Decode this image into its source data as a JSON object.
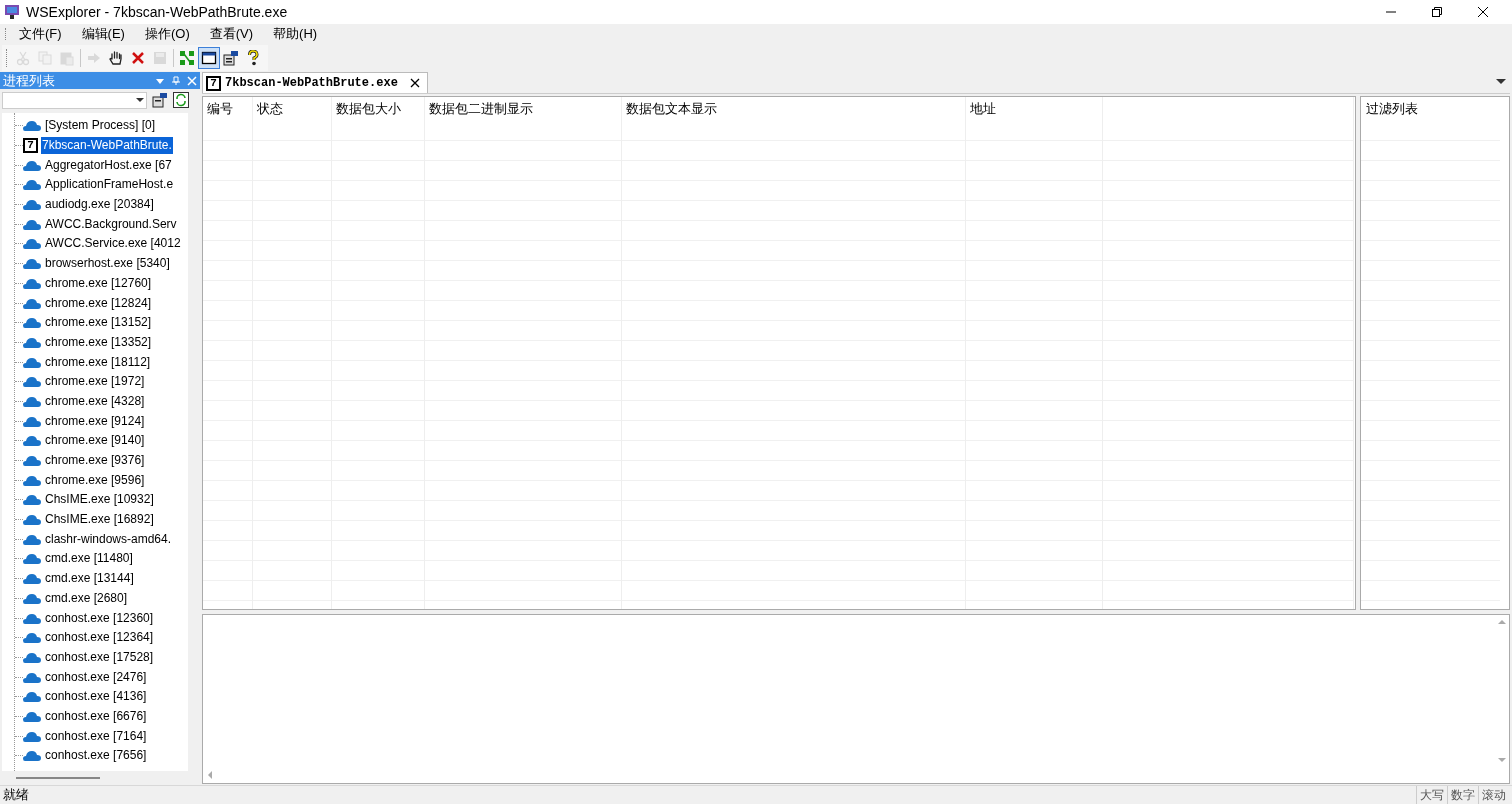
{
  "window": {
    "title": "WSExplorer - 7kbscan-WebPathBrute.exe"
  },
  "menu": [
    {
      "label": "文件(F)"
    },
    {
      "label": "编辑(E)"
    },
    {
      "label": "操作(O)"
    },
    {
      "label": "查看(V)"
    },
    {
      "label": "帮助(H)"
    }
  ],
  "toolbar": [
    {
      "kind": "cut",
      "disabled": true
    },
    {
      "kind": "copy",
      "disabled": true
    },
    {
      "kind": "paste",
      "disabled": true
    },
    {
      "kind": "sep"
    },
    {
      "kind": "forward",
      "disabled": true
    },
    {
      "kind": "hand",
      "disabled": false
    },
    {
      "kind": "delete",
      "disabled": false
    },
    {
      "kind": "save",
      "disabled": true
    },
    {
      "kind": "sep"
    },
    {
      "kind": "nodes",
      "disabled": false
    },
    {
      "kind": "window",
      "disabled": false,
      "selected": true
    },
    {
      "kind": "props",
      "disabled": false
    },
    {
      "kind": "help",
      "disabled": false
    }
  ],
  "sidebar": {
    "title": "进程列表",
    "items": [
      {
        "label": "[System Process] [0]",
        "kind": "cloud",
        "selected": false
      },
      {
        "label": "7kbscan-WebPathBrute.",
        "kind": "seven",
        "icon_label": "7",
        "selected": true
      },
      {
        "label": "AggregatorHost.exe [67",
        "kind": "cloud",
        "selected": false
      },
      {
        "label": "ApplicationFrameHost.e",
        "kind": "cloud",
        "selected": false
      },
      {
        "label": "audiodg.exe [20384]",
        "kind": "cloud",
        "selected": false
      },
      {
        "label": "AWCC.Background.Serv",
        "kind": "cloud",
        "selected": false
      },
      {
        "label": "AWCC.Service.exe [4012",
        "kind": "cloud",
        "selected": false
      },
      {
        "label": "browserhost.exe [5340]",
        "kind": "cloud",
        "selected": false
      },
      {
        "label": "chrome.exe [12760]",
        "kind": "cloud",
        "selected": false
      },
      {
        "label": "chrome.exe [12824]",
        "kind": "cloud",
        "selected": false
      },
      {
        "label": "chrome.exe [13152]",
        "kind": "cloud",
        "selected": false
      },
      {
        "label": "chrome.exe [13352]",
        "kind": "cloud",
        "selected": false
      },
      {
        "label": "chrome.exe [18112]",
        "kind": "cloud",
        "selected": false
      },
      {
        "label": "chrome.exe [1972]",
        "kind": "cloud",
        "selected": false
      },
      {
        "label": "chrome.exe [4328]",
        "kind": "cloud",
        "selected": false
      },
      {
        "label": "chrome.exe [9124]",
        "kind": "cloud",
        "selected": false
      },
      {
        "label": "chrome.exe [9140]",
        "kind": "cloud",
        "selected": false
      },
      {
        "label": "chrome.exe [9376]",
        "kind": "cloud",
        "selected": false
      },
      {
        "label": "chrome.exe [9596]",
        "kind": "cloud",
        "selected": false
      },
      {
        "label": "ChsIME.exe [10932]",
        "kind": "cloud",
        "selected": false
      },
      {
        "label": "ChsIME.exe [16892]",
        "kind": "cloud",
        "selected": false
      },
      {
        "label": "clashr-windows-amd64.",
        "kind": "cloud",
        "selected": false
      },
      {
        "label": "cmd.exe [11480]",
        "kind": "cloud",
        "selected": false
      },
      {
        "label": "cmd.exe [13144]",
        "kind": "cloud",
        "selected": false
      },
      {
        "label": "cmd.exe [2680]",
        "kind": "cloud",
        "selected": false
      },
      {
        "label": "conhost.exe [12360]",
        "kind": "cloud",
        "selected": false
      },
      {
        "label": "conhost.exe [12364]",
        "kind": "cloud",
        "selected": false
      },
      {
        "label": "conhost.exe [17528]",
        "kind": "cloud",
        "selected": false
      },
      {
        "label": "conhost.exe [2476]",
        "kind": "cloud",
        "selected": false
      },
      {
        "label": "conhost.exe [4136]",
        "kind": "cloud",
        "selected": false
      },
      {
        "label": "conhost.exe [6676]",
        "kind": "cloud",
        "selected": false
      },
      {
        "label": "conhost.exe [7164]",
        "kind": "cloud",
        "selected": false
      },
      {
        "label": "conhost.exe [7656]",
        "kind": "cloud",
        "selected": false
      }
    ]
  },
  "tabs": [
    {
      "label": "7kbscan-WebPathBrute.exe",
      "icon_label": "7",
      "selected": true
    }
  ],
  "table": {
    "columns": [
      "编号",
      "状态",
      "数据包大小",
      "数据包二进制显示",
      "数据包文本显示",
      "地址"
    ]
  },
  "filter": {
    "title": "过滤列表"
  },
  "status_bar": {
    "text": "就绪",
    "indicators": [
      "大写",
      "数字",
      "滚动"
    ]
  }
}
